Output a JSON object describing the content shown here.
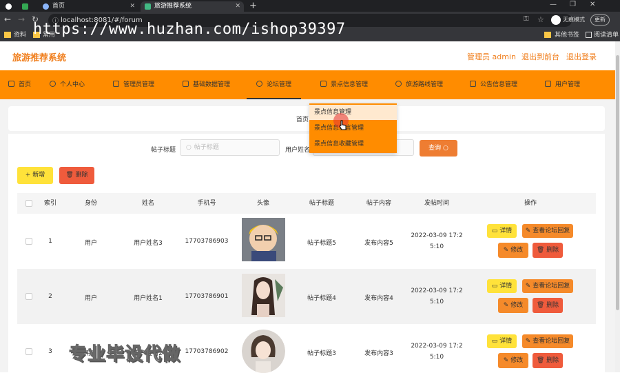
{
  "browser": {
    "tabs": [
      {
        "title": "",
        "favicon_color": "#ffffff"
      },
      {
        "title": "",
        "favicon_color": "#34a853"
      },
      {
        "title": "首页",
        "favicon_color": "#8ab4f8"
      },
      {
        "title": "旅游推荐系统",
        "favicon_color": "#42b883"
      }
    ],
    "url": "localhost:8081/#/forum",
    "incognito_label": "无痕模式",
    "update_label": "更新",
    "bookmarks": [
      "资料",
      "常用"
    ],
    "other_bookmarks": "其他书签",
    "reading_list": "阅读清单",
    "overlay_url": "https://www.huzhan.com/ishop39397"
  },
  "header": {
    "site_title": "旅游推荐系统",
    "admin_label": "管理员 admin",
    "back_label": "退出到前台",
    "logout_label": "退出登录"
  },
  "nav": [
    {
      "label": "首页"
    },
    {
      "label": "个人中心"
    },
    {
      "label": "管理员管理"
    },
    {
      "label": "基础数据管理"
    },
    {
      "label": "论坛管理"
    },
    {
      "label": "景点信息管理"
    },
    {
      "label": "旅游路线管理"
    },
    {
      "label": "公告信息管理"
    },
    {
      "label": "用户管理"
    }
  ],
  "dropdown": [
    {
      "label": "景点信息管理"
    },
    {
      "label": "景点信息留言管理"
    },
    {
      "label": "景点信息收藏管理"
    }
  ],
  "breadcrumb": {
    "home": "首页",
    "sep": "/"
  },
  "search": {
    "title_label": "帖子标题",
    "title_placeholder": "帖子标题",
    "user_label": "用户姓名",
    "query_label": "查询"
  },
  "actions": {
    "add": "新增",
    "delete": "删除"
  },
  "table": {
    "headers": [
      "索引",
      "身份",
      "姓名",
      "手机号",
      "头像",
      "帖子标题",
      "帖子内容",
      "发帖时间",
      "操作"
    ],
    "rows": [
      {
        "index": "1",
        "role": "用户",
        "name": "用户姓名3",
        "phone": "17703786903",
        "title": "帖子标题5",
        "content": "发布内容5",
        "time1": "2022-03-09 17:2",
        "time2": "5:10"
      },
      {
        "index": "2",
        "role": "用户",
        "name": "用户姓名1",
        "phone": "17703786901",
        "title": "帖子标题4",
        "content": "发布内容4",
        "time1": "2022-03-09 17:2",
        "time2": "5:10"
      },
      {
        "index": "3",
        "role": "用户",
        "name": "用户姓名2",
        "phone": "17703786902",
        "title": "帖子标题3",
        "content": "发布内容3",
        "time1": "2022-03-09 17:2",
        "time2": "5:10"
      }
    ],
    "row_actions": {
      "detail": "详情",
      "view_replies": "查看论坛回复",
      "edit": "修改",
      "delete": "删除"
    }
  },
  "watermark_text": "专业毕设代做"
}
